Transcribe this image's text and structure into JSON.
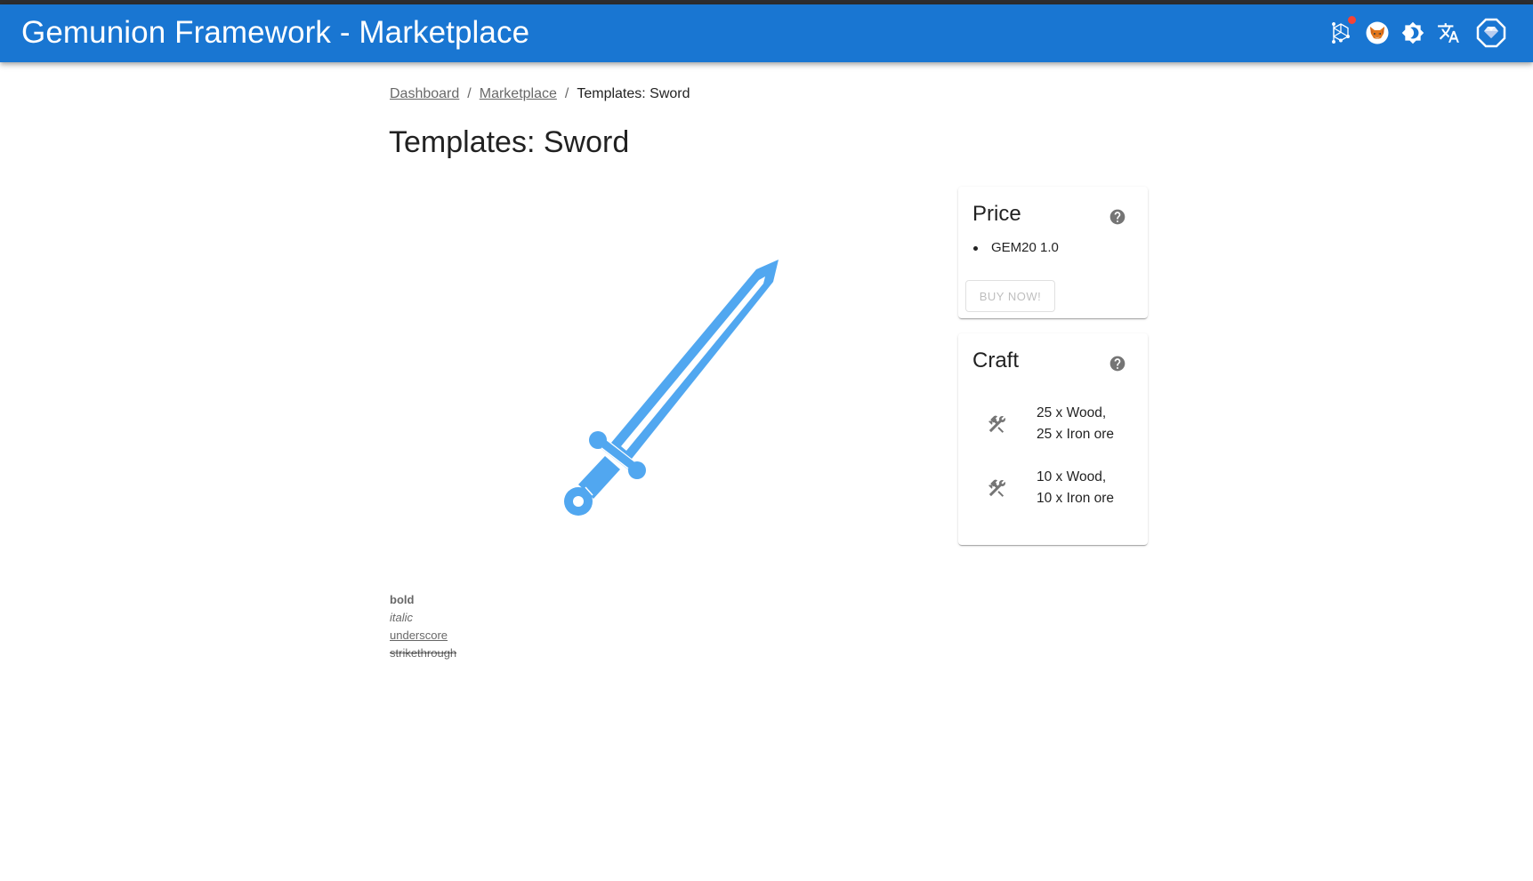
{
  "appbar": {
    "title": "Gemunion Framework - Marketplace",
    "background_color": "#1976d2",
    "icons": [
      {
        "name": "network-icon",
        "has_notification_badge": true
      },
      {
        "name": "metamask-fox-icon"
      },
      {
        "name": "theme-toggle-icon"
      },
      {
        "name": "translate-icon"
      },
      {
        "name": "gemunion-logo-icon"
      }
    ]
  },
  "breadcrumb": {
    "items": [
      {
        "label": "Dashboard",
        "link": true
      },
      {
        "label": "Marketplace",
        "link": true
      },
      {
        "label": "Templates: Sword",
        "link": false
      }
    ],
    "separator": "/"
  },
  "page": {
    "title": "Templates: Sword",
    "image": {
      "name": "sword",
      "color": "#51a7f0"
    }
  },
  "description": {
    "bold": "bold",
    "italic": "italic",
    "underscore": "underscore",
    "strikethrough": "strikethrough"
  },
  "price_card": {
    "title": "Price",
    "items": [
      "GEM20 1.0"
    ],
    "buy_button": "BUY NOW!",
    "buy_button_disabled": true
  },
  "craft_card": {
    "title": "Craft",
    "recipes": [
      {
        "line1": "25 x Wood,",
        "line2": "25 x Iron ore"
      },
      {
        "line1": "10 x Wood,",
        "line2": "10 x Iron ore"
      }
    ]
  }
}
